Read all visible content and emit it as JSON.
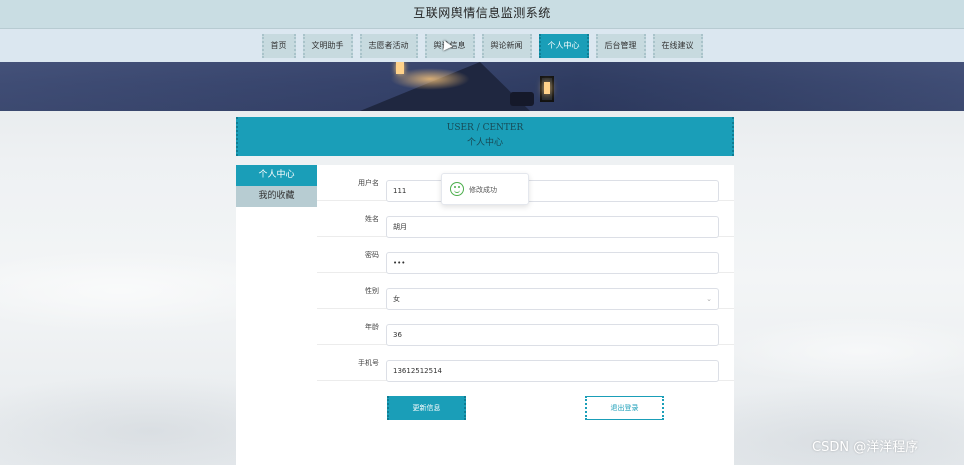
{
  "app": {
    "title": "互联网舆情信息监测系统"
  },
  "nav": {
    "items": [
      {
        "label": "首页",
        "active": false
      },
      {
        "label": "文明助手",
        "active": false
      },
      {
        "label": "志愿者活动",
        "active": false
      },
      {
        "label": "舆论信息",
        "active": false
      },
      {
        "label": "舆论新闻",
        "active": false
      },
      {
        "label": "个人中心",
        "active": true
      },
      {
        "label": "后台管理",
        "active": false
      },
      {
        "label": "在线建议",
        "active": false
      }
    ]
  },
  "user_center": {
    "title_en": "USER / CENTER",
    "title_cn": "个人中心"
  },
  "sidebar": {
    "items": [
      {
        "label": "个人中心",
        "active": true
      },
      {
        "label": "我的收藏",
        "active": false
      }
    ]
  },
  "form": {
    "fields": [
      {
        "label": "用户名",
        "value": "111"
      },
      {
        "label": "姓名",
        "value": "胡月"
      },
      {
        "label": "密码",
        "value": "•••"
      },
      {
        "label": "性别",
        "value": "女"
      },
      {
        "label": "年龄",
        "value": "36"
      },
      {
        "label": "手机号",
        "value": "13612512514"
      }
    ],
    "update_label": "更新信息",
    "logout_label": "退出登录"
  },
  "toast": {
    "message": "修改成功",
    "icon": "smile-icon"
  },
  "watermark": "CSDN @洋洋程序",
  "colors": {
    "accent": "#1a9eb8",
    "nav_bg": "#dbe7f0",
    "title_bg": "#c9dde3"
  }
}
